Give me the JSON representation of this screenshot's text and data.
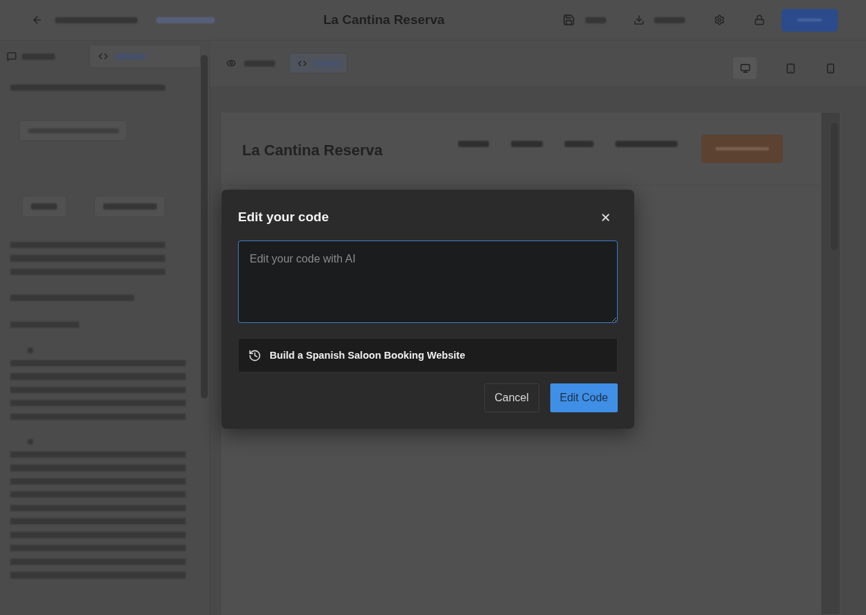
{
  "app_bar": {
    "title": "La Cantina Reserva"
  },
  "preview": {
    "site_title": "La Cantina Reserva"
  },
  "dialog": {
    "title": "Edit your code",
    "prompt_field": {
      "placeholder": "Edit your code with AI"
    },
    "history": [
      {
        "label": "Build a Spanish Saloon Booking Website"
      }
    ],
    "buttons": [
      {
        "label": "Cancel",
        "kind": "secondary"
      },
      {
        "label": "Edit Code",
        "kind": "primary"
      }
    ]
  }
}
